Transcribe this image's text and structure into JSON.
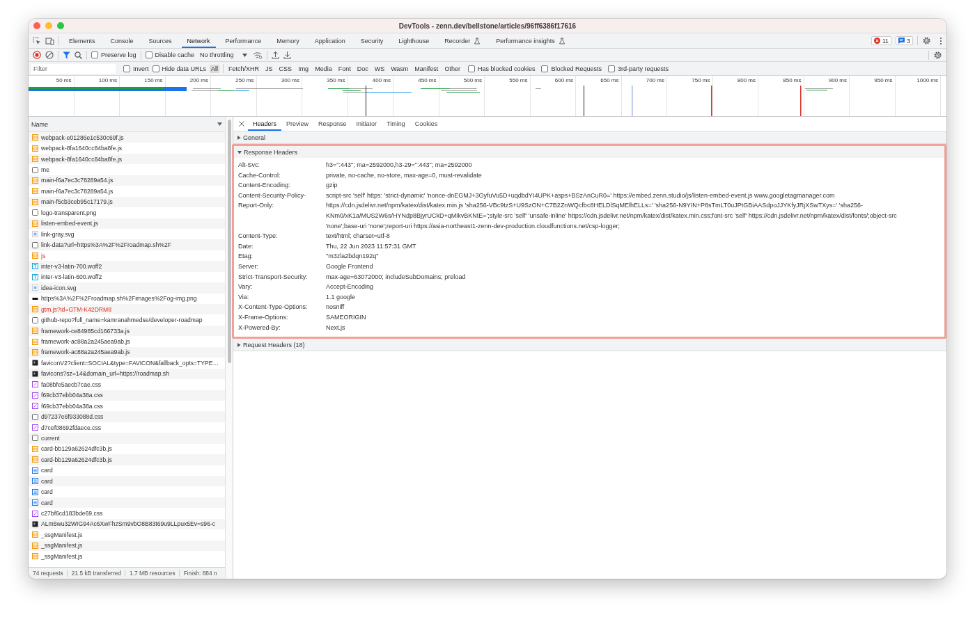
{
  "window": {
    "title": "DevTools - zenn.dev/bellstone/articles/96ff6386f17616"
  },
  "panel_tabs": [
    {
      "label": "Elements",
      "selected": false,
      "experimental": false
    },
    {
      "label": "Console",
      "selected": false,
      "experimental": false
    },
    {
      "label": "Sources",
      "selected": false,
      "experimental": false
    },
    {
      "label": "Network",
      "selected": true,
      "experimental": false
    },
    {
      "label": "Performance",
      "selected": false,
      "experimental": false
    },
    {
      "label": "Memory",
      "selected": false,
      "experimental": false
    },
    {
      "label": "Application",
      "selected": false,
      "experimental": false
    },
    {
      "label": "Security",
      "selected": false,
      "experimental": false
    },
    {
      "label": "Lighthouse",
      "selected": false,
      "experimental": false
    },
    {
      "label": "Recorder",
      "selected": false,
      "experimental": true
    },
    {
      "label": "Performance insights",
      "selected": false,
      "experimental": true
    }
  ],
  "counters": {
    "errors": "11",
    "messages": "3"
  },
  "toolbar": {
    "preserve_log": {
      "label": "Preserve log",
      "checked": false
    },
    "disable_cache": {
      "label": "Disable cache",
      "checked": false
    },
    "throttling": "No throttling"
  },
  "filter_bar": {
    "placeholder": "Filter",
    "toggles": [
      {
        "label": "Invert",
        "checked": false
      },
      {
        "label": "Hide data URLs",
        "checked": false
      }
    ],
    "types": [
      {
        "label": "All",
        "selected": true
      },
      {
        "label": "Fetch/XHR",
        "selected": false
      },
      {
        "label": "JS",
        "selected": false
      },
      {
        "label": "CSS",
        "selected": false
      },
      {
        "label": "Img",
        "selected": false
      },
      {
        "label": "Media",
        "selected": false
      },
      {
        "label": "Font",
        "selected": false
      },
      {
        "label": "Doc",
        "selected": false
      },
      {
        "label": "WS",
        "selected": false
      },
      {
        "label": "Wasm",
        "selected": false
      },
      {
        "label": "Manifest",
        "selected": false
      },
      {
        "label": "Other",
        "selected": false
      }
    ],
    "options": [
      {
        "label": "Has blocked cookies",
        "checked": false
      },
      {
        "label": "Blocked Requests",
        "checked": false
      },
      {
        "label": "3rd-party requests",
        "checked": false
      }
    ]
  },
  "timeline": {
    "ticks": [
      "50 ms",
      "100 ms",
      "150 ms",
      "200 ms",
      "250 ms",
      "300 ms",
      "350 ms",
      "400 ms",
      "450 ms",
      "500 ms",
      "550 ms",
      "600 ms",
      "650 ms",
      "700 ms",
      "750 ms",
      "800 ms",
      "850 ms",
      "900 ms",
      "950 ms",
      "1000 ms"
    ]
  },
  "requests": {
    "column": "Name",
    "rows": [
      {
        "name": "webpack-e01286e1c530c69f.js",
        "kind": "script",
        "failed": false
      },
      {
        "name": "webpack-8fa1640cc84ba8fe.js",
        "kind": "script",
        "failed": false
      },
      {
        "name": "webpack-8fa1640cc84ba8fe.js",
        "kind": "script",
        "failed": false
      },
      {
        "name": "me",
        "kind": "doc",
        "failed": false
      },
      {
        "name": "main-f6a7ec3c78289a54.js",
        "kind": "script",
        "failed": false
      },
      {
        "name": "main-f6a7ec3c78289a54.js",
        "kind": "script",
        "failed": false
      },
      {
        "name": "main-f5cb3ceb95c17179.js",
        "kind": "script",
        "failed": false
      },
      {
        "name": "logo-transparent.png",
        "kind": "doc",
        "failed": false
      },
      {
        "name": "listen-embed-event.js",
        "kind": "script",
        "failed": false
      },
      {
        "name": "link-gray.svg",
        "kind": "svg",
        "failed": false
      },
      {
        "name": "link-data?url=https%3A%2F%2Froadmap.sh%2F",
        "kind": "doc",
        "failed": false
      },
      {
        "name": "js",
        "kind": "script",
        "failed": true
      },
      {
        "name": "inter-v3-latin-700.woff2",
        "kind": "font",
        "failed": false
      },
      {
        "name": "inter-v3-latin-600.woff2",
        "kind": "font",
        "failed": false
      },
      {
        "name": "idea-icon.svg",
        "kind": "svg",
        "failed": false
      },
      {
        "name": "https%3A%2F%2Froadmap.sh%2Fimages%2Fog-img.png",
        "kind": "image",
        "failed": false
      },
      {
        "name": "gtm.js?id=GTM-K42DRM8",
        "kind": "script",
        "failed": true
      },
      {
        "name": "github-repo?full_name=kamranahmedse/developer-roadmap",
        "kind": "doc",
        "failed": false
      },
      {
        "name": "framework-ce84985cd166733a.js",
        "kind": "script",
        "failed": false
      },
      {
        "name": "framework-ac88a2a245aea9ab.js",
        "kind": "script",
        "failed": false
      },
      {
        "name": "framework-ac88a2a245aea9ab.js",
        "kind": "script",
        "failed": false
      },
      {
        "name": "faviconV2?client=SOCIAL&type=FAVICON&fallback_opts=TYPE…",
        "kind": "favicon",
        "failed": false
      },
      {
        "name": "favicons?sz=14&domain_url=https://roadmap.sh",
        "kind": "favicon",
        "failed": false
      },
      {
        "name": "fa08bfe5aecb7cae.css",
        "kind": "stylesheet",
        "failed": false
      },
      {
        "name": "f69cb37ebb04a38a.css",
        "kind": "stylesheet",
        "failed": false
      },
      {
        "name": "f69cb37ebb04a38a.css",
        "kind": "stylesheet",
        "failed": false
      },
      {
        "name": "d97237e6f933088d.css",
        "kind": "doc",
        "failed": false
      },
      {
        "name": "d7cef08692fdaece.css",
        "kind": "stylesheet",
        "failed": false
      },
      {
        "name": "current",
        "kind": "doc",
        "failed": false
      },
      {
        "name": "card-bb129a62624dfc3b.js",
        "kind": "script",
        "failed": false
      },
      {
        "name": "card-bb129a62624dfc3b.js",
        "kind": "script",
        "failed": false
      },
      {
        "name": "card",
        "kind": "fetch",
        "failed": false
      },
      {
        "name": "card",
        "kind": "fetch",
        "failed": false
      },
      {
        "name": "card",
        "kind": "fetch",
        "failed": false
      },
      {
        "name": "card",
        "kind": "fetch",
        "failed": false
      },
      {
        "name": "c27bf6cd183bde69.css",
        "kind": "stylesheet",
        "failed": false
      },
      {
        "name": "ALm5wu32WIG94Ac6XwFhzSm9vbO8B83t69u9LLpux5Ev=s96-c",
        "kind": "favicon",
        "failed": false
      },
      {
        "name": "_ssgManifest.js",
        "kind": "script",
        "failed": false
      },
      {
        "name": "_ssgManifest.js",
        "kind": "script",
        "failed": false
      },
      {
        "name": "_ssgManifest.js",
        "kind": "script",
        "failed": false
      }
    ]
  },
  "details": {
    "tabs": [
      {
        "label": "Headers",
        "selected": true
      },
      {
        "label": "Preview",
        "selected": false
      },
      {
        "label": "Response",
        "selected": false
      },
      {
        "label": "Initiator",
        "selected": false
      },
      {
        "label": "Timing",
        "selected": false
      },
      {
        "label": "Cookies",
        "selected": false
      }
    ],
    "sections": [
      {
        "title": "General",
        "expanded": false,
        "highlighted": false
      },
      {
        "title": "Response Headers",
        "expanded": true,
        "highlighted": true,
        "headers": [
          {
            "name": "Alt-Svc:",
            "value": "h3=\":443\"; ma=2592000,h3-29=\":443\"; ma=2592000"
          },
          {
            "name": "Cache-Control:",
            "value": "private, no-cache, no-store, max-age=0, must-revalidate"
          },
          {
            "name": "Content-Encoding:",
            "value": "gzip"
          },
          {
            "name": "Content-Security-Policy-Report-Only:",
            "value": "script-src 'self' https: 'strict-dynamic' 'nonce-dnEGMJ+3GyfuVu5D+uqdbdYI4UPK+asps+BSzAnCuR0=' https://embed.zenn.studio/js/listen-embed-event.js www.googletagmanager.com https://cdn.jsdelivr.net/npm/katex/dist/katex.min.js 'sha256-VBc9tzS+U9SzON+C7B2ZnWQcfbc8HELDlSqMElhELLs=' 'sha256-N9YIN+P8sTmLT0uJPtGBiAASdpoJJYKfyJRjXSwTXys=' 'sha256-KNm0/xK1a/MUS2W6s/HYNdp8BjyrUCkD+qMikvBKNtE=';style-src 'self' 'unsafe-inline' https://cdn.jsdelivr.net/npm/katex/dist/katex.min.css;font-src 'self' https://cdn.jsdelivr.net/npm/katex/dist/fonts/;object-src 'none';base-uri 'none';report-uri https://asia-northeast1-zenn-dev-production.cloudfunctions.net/csp-logger;"
          },
          {
            "name": "Content-Type:",
            "value": "text/html; charset=utf-8"
          },
          {
            "name": "Date:",
            "value": "Thu, 22 Jun 2023 11:57:31 GMT"
          },
          {
            "name": "Etag:",
            "value": "\"m3zla2bdqn192q\""
          },
          {
            "name": "Server:",
            "value": "Google Frontend"
          },
          {
            "name": "Strict-Transport-Security:",
            "value": "max-age=63072000; includeSubDomains; preload"
          },
          {
            "name": "Vary:",
            "value": "Accept-Encoding"
          },
          {
            "name": "Via:",
            "value": "1.1 google"
          },
          {
            "name": "X-Content-Type-Options:",
            "value": "nosniff"
          },
          {
            "name": "X-Frame-Options:",
            "value": "SAMEORIGIN"
          },
          {
            "name": "X-Powered-By:",
            "value": "Next.js"
          }
        ]
      },
      {
        "title": "Request Headers (18)",
        "expanded": false,
        "highlighted": false
      }
    ]
  },
  "status_bar": [
    "74 requests",
    "21.5 kB transferred",
    "1.7 MB resources",
    "Finish: 884 n"
  ]
}
